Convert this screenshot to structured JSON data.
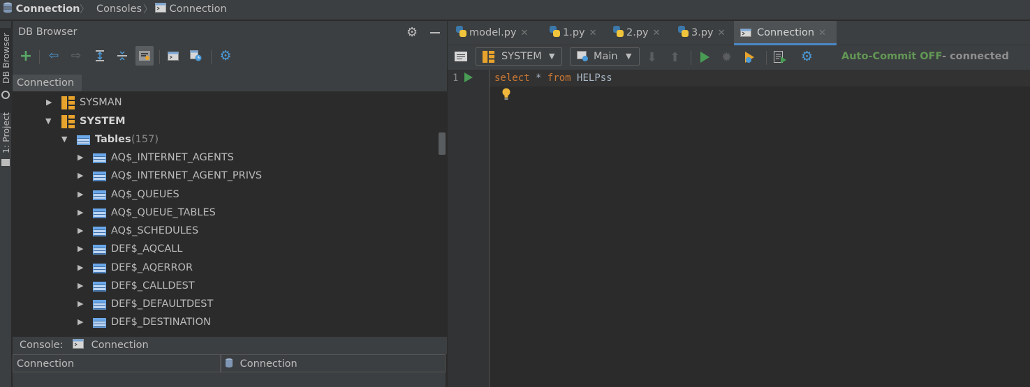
{
  "breadcrumb": {
    "items": [
      "Connection",
      "Consoles",
      "Connection"
    ]
  },
  "left_strip": {
    "tabs": [
      "DB Browser",
      "1: Project"
    ]
  },
  "db_browser": {
    "title": "DB Browser",
    "connection_tab": "Connection",
    "tree": {
      "schemas": [
        {
          "name": "SYSMAN",
          "expanded": false
        },
        {
          "name": "SYSTEM",
          "expanded": true
        }
      ],
      "tables_folder": {
        "label": "Tables",
        "count": "(157)"
      },
      "tables": [
        "AQ$_INTERNET_AGENTS",
        "AQ$_INTERNET_AGENT_PRIVS",
        "AQ$_QUEUES",
        "AQ$_QUEUE_TABLES",
        "AQ$_SCHEDULES",
        "DEF$_AQCALL",
        "DEF$_AQERROR",
        "DEF$_CALLDEST",
        "DEF$_DEFAULTDEST",
        "DEF$_DESTINATION"
      ]
    },
    "console_label": "Console:",
    "console_value": "Connection",
    "bottom_table": {
      "col1": "Connection",
      "col2": "Connection"
    }
  },
  "editor_tabs": [
    {
      "label": "model.py",
      "active": false
    },
    {
      "label": "1.py",
      "active": false
    },
    {
      "label": "2.py",
      "active": false
    },
    {
      "label": "3.py",
      "active": false
    },
    {
      "label": "Connection",
      "active": true
    }
  ],
  "editor_toolbar": {
    "schema_combo": "SYSTEM",
    "session_combo": "Main",
    "autocommit": "Auto-Commit OFF",
    "status": "- connected"
  },
  "editor": {
    "line_number": "1",
    "code": {
      "kw1": "select",
      "op": "*",
      "kw2": "from",
      "ident": "HELPss"
    }
  },
  "colors": {
    "keyword": "#cc7832",
    "autocommit": "#629755",
    "accent_tab": "#4a88c7",
    "run_green": "#499c54"
  }
}
